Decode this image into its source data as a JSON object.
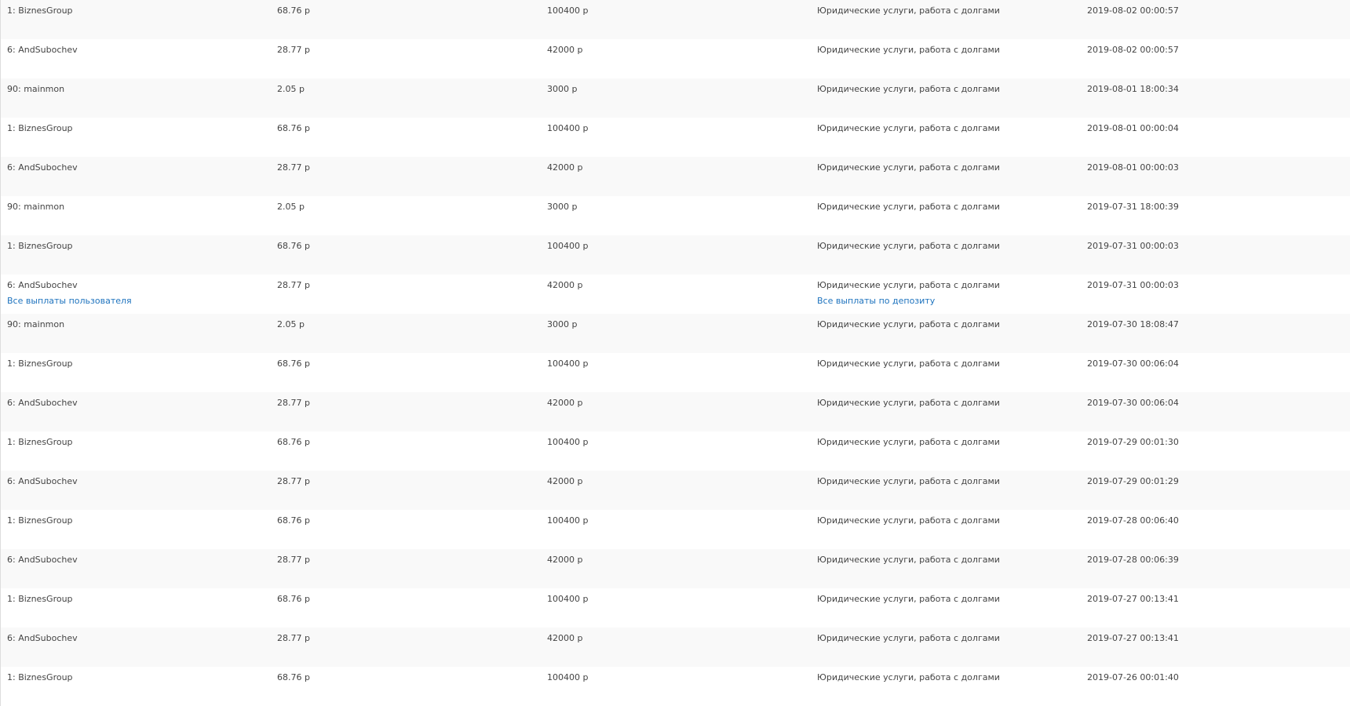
{
  "table": {
    "rows": [
      {
        "user": "1: BiznesGroup",
        "amount": "68.76 р",
        "deposit": "100400 р",
        "plan": "Юридические услуги, работа с долгами",
        "date": "2019-08-02 00:00:57"
      },
      {
        "user": "6: AndSubochev",
        "amount": "28.77 р",
        "deposit": "42000 р",
        "plan": "Юридические услуги, работа с долгами",
        "date": "2019-08-02 00:00:57"
      },
      {
        "user": "90: mainmon",
        "amount": "2.05 р",
        "deposit": "3000 р",
        "plan": "Юридические услуги, работа с долгами",
        "date": "2019-08-01 18:00:34"
      },
      {
        "user": "1: BiznesGroup",
        "amount": "68.76 р",
        "deposit": "100400 р",
        "plan": "Юридические услуги, работа с долгами",
        "date": "2019-08-01 00:00:04"
      },
      {
        "user": "6: AndSubochev",
        "amount": "28.77 р",
        "deposit": "42000 р",
        "plan": "Юридические услуги, работа с долгами",
        "date": "2019-08-01 00:00:03"
      },
      {
        "user": "90: mainmon",
        "amount": "2.05 р",
        "deposit": "3000 р",
        "plan": "Юридические услуги, работа с долгами",
        "date": "2019-07-31 18:00:39"
      },
      {
        "user": "1: BiznesGroup",
        "amount": "68.76 р",
        "deposit": "100400 р",
        "plan": "Юридические услуги, работа с долгами",
        "date": "2019-07-31 00:00:03"
      },
      {
        "user": "6: AndSubochev",
        "amount": "28.77 р",
        "deposit": "42000 р",
        "plan": "Юридические услуги, работа с долгами",
        "date": "2019-07-31 00:00:03",
        "user_link": "Все выплаты пользователя",
        "deposit_link": "Все выплаты по депозиту"
      },
      {
        "user": "90: mainmon",
        "amount": "2.05 р",
        "deposit": "3000 р",
        "plan": "Юридические услуги, работа с долгами",
        "date": "2019-07-30 18:08:47"
      },
      {
        "user": "1: BiznesGroup",
        "amount": "68.76 р",
        "deposit": "100400 р",
        "plan": "Юридические услуги, работа с долгами",
        "date": "2019-07-30 00:06:04"
      },
      {
        "user": "6: AndSubochev",
        "amount": "28.77 р",
        "deposit": "42000 р",
        "plan": "Юридические услуги, работа с долгами",
        "date": "2019-07-30 00:06:04"
      },
      {
        "user": "1: BiznesGroup",
        "amount": "68.76 р",
        "deposit": "100400 р",
        "plan": "Юридические услуги, работа с долгами",
        "date": "2019-07-29 00:01:30"
      },
      {
        "user": "6: AndSubochev",
        "amount": "28.77 р",
        "deposit": "42000 р",
        "plan": "Юридические услуги, работа с долгами",
        "date": "2019-07-29 00:01:29"
      },
      {
        "user": "1: BiznesGroup",
        "amount": "68.76 р",
        "deposit": "100400 р",
        "plan": "Юридические услуги, работа с долгами",
        "date": "2019-07-28 00:06:40"
      },
      {
        "user": "6: AndSubochev",
        "amount": "28.77 р",
        "deposit": "42000 р",
        "plan": "Юридические услуги, работа с долгами",
        "date": "2019-07-28 00:06:39"
      },
      {
        "user": "1: BiznesGroup",
        "amount": "68.76 р",
        "deposit": "100400 р",
        "plan": "Юридические услуги, работа с долгами",
        "date": "2019-07-27 00:13:41"
      },
      {
        "user": "6: AndSubochev",
        "amount": "28.77 р",
        "deposit": "42000 р",
        "plan": "Юридические услуги, работа с долгами",
        "date": "2019-07-27 00:13:41"
      },
      {
        "user": "1: BiznesGroup",
        "amount": "68.76 р",
        "deposit": "100400 р",
        "plan": "Юридические услуги, работа с долгами",
        "date": "2019-07-26 00:01:40"
      }
    ]
  }
}
